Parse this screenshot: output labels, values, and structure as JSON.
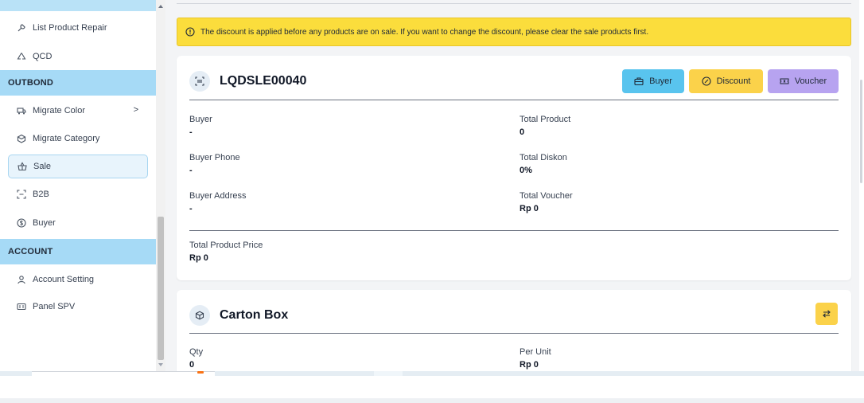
{
  "sidebar": {
    "items": [
      {
        "label": "List Product Repair",
        "icon": "wrench-icon"
      },
      {
        "label": "QCD",
        "icon": "recycle-icon"
      }
    ],
    "section_outbond": "OUTBOND",
    "outbond_items": [
      {
        "label": "Migrate Color",
        "icon": "truck-icon",
        "chevron": ">"
      },
      {
        "label": "Migrate Category",
        "icon": "box-icon"
      },
      {
        "label": "Sale",
        "icon": "basket-icon"
      },
      {
        "label": "B2B",
        "icon": "scan-icon"
      },
      {
        "label": "Buyer",
        "icon": "dollar-circle-icon"
      }
    ],
    "section_account": "ACCOUNT",
    "account_items": [
      {
        "label": "Account Setting",
        "icon": "user-icon"
      },
      {
        "label": "Panel SPV",
        "icon": "id-card-icon"
      }
    ]
  },
  "alert": {
    "text": "The discount is applied before any products are on sale. If you want to change the discount, please clear the sale products first.",
    "icon": "info-circle-icon"
  },
  "sale_card": {
    "code": "LQDSLE00040",
    "icon": "barcode-scan-icon",
    "buttons": {
      "buyer": "Buyer",
      "discount": "Discount",
      "voucher": "Voucher"
    },
    "fields": {
      "buyer_label": "Buyer",
      "buyer_value": "-",
      "buyer_phone_label": "Buyer Phone",
      "buyer_phone_value": "-",
      "buyer_address_label": "Buyer Address",
      "buyer_address_value": "-",
      "total_product_label": "Total Product",
      "total_product_value": "0",
      "total_diskon_label": "Total Diskon",
      "total_diskon_value": "0%",
      "total_voucher_label": "Total Voucher",
      "total_voucher_value": "Rp 0",
      "total_price_label": "Total Product Price",
      "total_price_value": "Rp 0"
    }
  },
  "carton_card": {
    "title": "Carton Box",
    "icon": "package-icon",
    "fields": {
      "qty_label": "Qty",
      "qty_value": "0",
      "per_unit_label": "Per Unit",
      "per_unit_value": "Rp 0"
    }
  },
  "colors": {
    "sidebar_section": "#a6daf6",
    "alert": "#fbdd3c",
    "buyer_button": "#59c4ee",
    "discount_button": "#fbd24a",
    "voucher_button": "#b7a3f0"
  }
}
